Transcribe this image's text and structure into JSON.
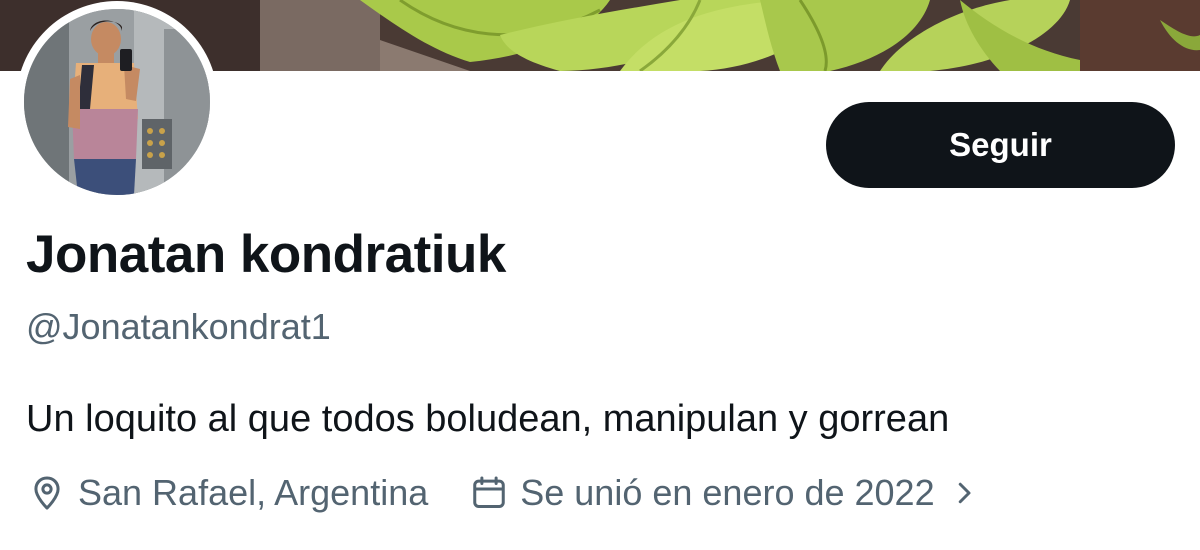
{
  "profile": {
    "display_name": "Jonatan kondratiuk",
    "handle": "@Jonatankondrat1",
    "bio": "Un loquito al que todos boludean, manipulan y gorrean",
    "location": "San Rafael, Argentina",
    "joined": "Se unió en enero de 2022"
  },
  "actions": {
    "follow_label": "Seguir"
  },
  "icons": {
    "location": "map-pin-icon",
    "joined": "calendar-icon",
    "expand": "chevron-right-icon"
  },
  "colors": {
    "primary_text": "#0f1419",
    "secondary_text": "#536471",
    "button_bg": "#0f1419",
    "button_text": "#ffffff",
    "background": "#ffffff"
  }
}
